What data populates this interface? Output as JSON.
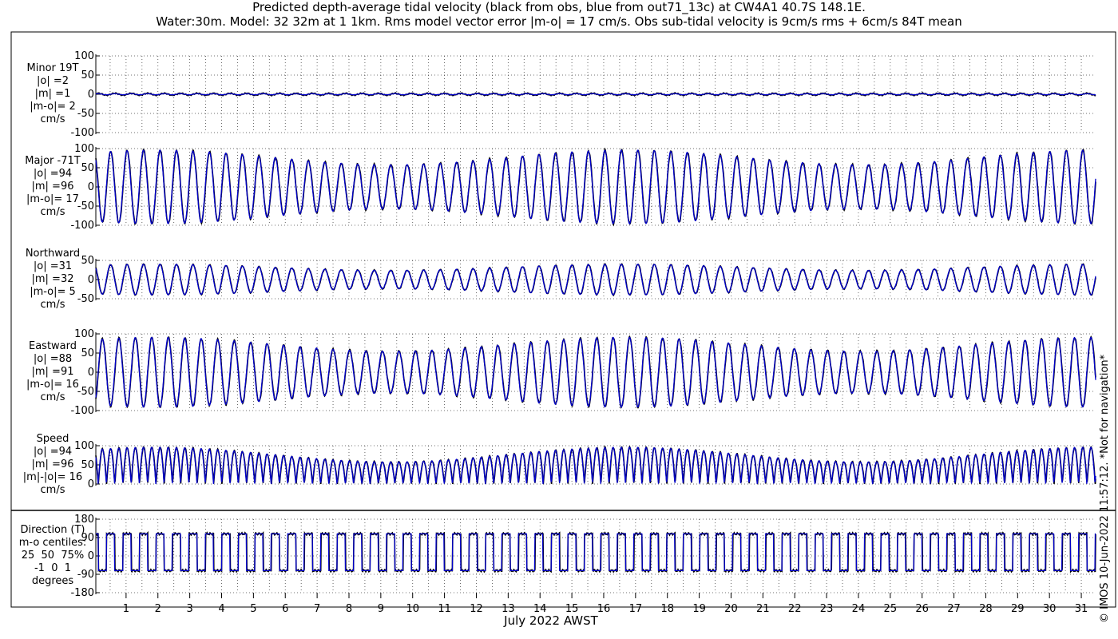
{
  "title_line1": "Predicted depth-average tidal velocity (black from obs, blue from out71_13c) at CW4A1 40.7S 148.1E.",
  "title_line2": "Water:30m. Model: 32 32m at 1 1km. Rms model vector error |m-o| = 17 cm/s. Obs sub-tidal velocity is 9cm/s rms + 6cm/s 84T mean",
  "xlabel": "July 2022 AWST",
  "stamp": "© IMOS 10-Jun-2022 11:57:12. *Not for navigation*",
  "colors": {
    "obs": "#000000",
    "model": "#0000cc"
  },
  "chart_data": {
    "type": "line",
    "x_range": [
      0.05,
      31.45
    ],
    "x_ticks": [
      "1",
      "2",
      "3",
      "4",
      "5",
      "6",
      "7",
      "8",
      "9",
      "10",
      "11",
      "12",
      "13",
      "14",
      "15",
      "16",
      "17",
      "18",
      "19",
      "20",
      "21",
      "22",
      "23",
      "24",
      "25",
      "26",
      "27",
      "28",
      "29",
      "30",
      "31"
    ],
    "grid": true,
    "series_names": [
      "obs",
      "out71_13c"
    ],
    "panels": [
      {
        "id": "minor",
        "label_lines": [
          "Minor 19T",
          "|o| =2",
          "|m| =1",
          "|m-o|= 2",
          "cm/s"
        ],
        "ylim": [
          -100,
          100
        ],
        "yticks": [
          "100",
          "50",
          "0",
          "-50",
          "-100"
        ],
        "amplitude": 2
      },
      {
        "id": "major",
        "label_lines": [
          "Major -71T",
          "|o| =94",
          "|m| =96",
          "|m-o|= 17",
          "cm/s"
        ],
        "ylim": [
          -100,
          100
        ],
        "yticks": [
          "100",
          "50",
          "0",
          "-50",
          "-100"
        ],
        "amplitude": 96
      },
      {
        "id": "north",
        "label_lines": [
          "Northward",
          "|o| =31",
          "|m| =32",
          "|m-o|= 5",
          "cm/s"
        ],
        "ylim": [
          -50,
          50
        ],
        "yticks": [
          "50",
          "0",
          "-50"
        ],
        "amplitude": 32
      },
      {
        "id": "east",
        "label_lines": [
          "Eastward",
          "|o| =88",
          "|m| =91",
          "|m-o|= 16",
          "cm/s"
        ],
        "ylim": [
          -100,
          100
        ],
        "yticks": [
          "100",
          "50",
          "0",
          "-50",
          "-100"
        ],
        "amplitude": 91
      },
      {
        "id": "speed",
        "label_lines": [
          "Speed",
          "|o| =94",
          "|m| =96",
          "|m|-|o|= 16",
          "cm/s"
        ],
        "ylim": [
          0,
          100
        ],
        "yticks": [
          "100",
          "50",
          "0"
        ],
        "amplitude": 96
      },
      {
        "id": "dir",
        "label_lines": [
          "Direction (T)",
          "m-o centiles:",
          "25  50  75%",
          "-1  0  1",
          "degrees"
        ],
        "ylim": [
          -180,
          180
        ],
        "yticks": [
          "180",
          "90",
          "0",
          "-90",
          "-180"
        ],
        "levels": [
          108,
          -72
        ]
      }
    ]
  }
}
